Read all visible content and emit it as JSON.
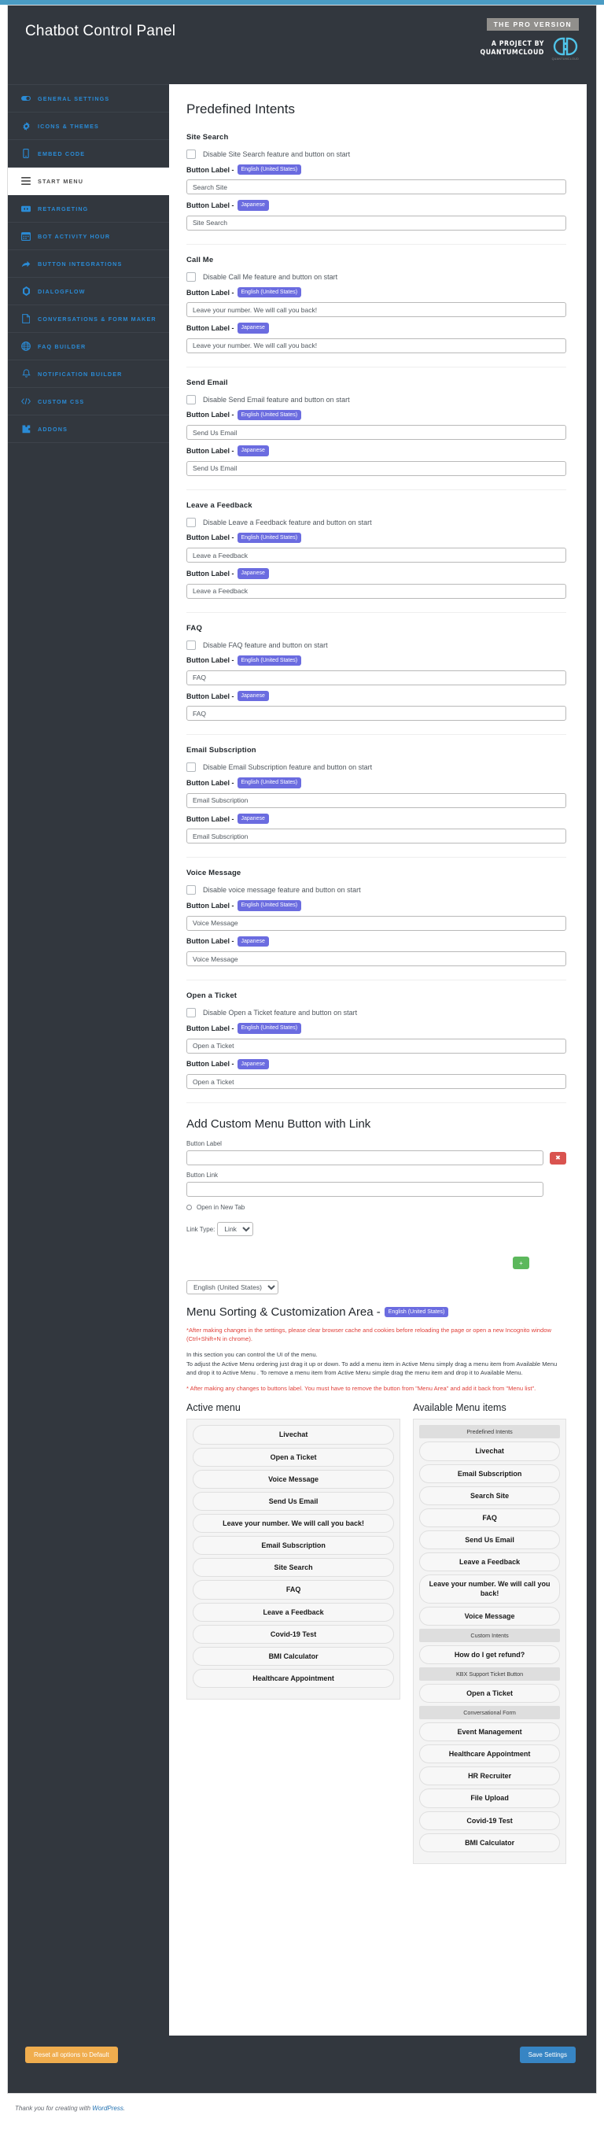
{
  "header": {
    "title": "Chatbot Control Panel",
    "pro_badge": "THE PRO VERSION",
    "project_by_line1": "A PROJECT BY",
    "project_by_line2": "QUANTUMCLOUD",
    "logo_caption": "QUANTUMCLOUD"
  },
  "sidebar": {
    "items": [
      {
        "label": "General Settings",
        "icon": "toggle-icon",
        "active": false
      },
      {
        "label": "Icons & Themes",
        "icon": "gear-icon",
        "active": false
      },
      {
        "label": "Embed Code",
        "icon": "mobile-icon",
        "active": false
      },
      {
        "label": "Start Menu",
        "icon": "hamburger-icon",
        "active": true
      },
      {
        "label": "Retargeting",
        "icon": "retarget-icon",
        "active": false
      },
      {
        "label": "Bot Activity Hour",
        "icon": "calendar-icon",
        "active": false
      },
      {
        "label": "Button Integrations",
        "icon": "share-icon",
        "active": false
      },
      {
        "label": "Dialogflow",
        "icon": "dialogflow-icon",
        "active": false
      },
      {
        "label": "Conversations & Form Maker",
        "icon": "document-icon",
        "active": false
      },
      {
        "label": "FAQ Builder",
        "icon": "globe-icon",
        "active": false
      },
      {
        "label": "Notification Builder",
        "icon": "bell-icon",
        "active": false
      },
      {
        "label": "Custom CSS",
        "icon": "code-icon",
        "active": false
      },
      {
        "label": "Addons",
        "icon": "puzzle-icon",
        "active": false
      }
    ]
  },
  "main": {
    "section_title": "Predefined Intents",
    "lang_en": "English (United States)",
    "lang_jp": "Japanese",
    "button_label_prefix": "Button Label -",
    "intents": [
      {
        "name": "Site Search",
        "disable_label": "Disable Site Search feature and button on start",
        "value_en": "Search Site",
        "value_jp": "Site Search"
      },
      {
        "name": "Call Me",
        "disable_label": "Disable Call Me feature and button on start",
        "value_en": "Leave your number. We will call you back!",
        "value_jp": "Leave your number. We will call you back!"
      },
      {
        "name": "Send Email",
        "disable_label": "Disable Send Email feature and button on start",
        "value_en": "Send Us Email",
        "value_jp": "Send Us Email"
      },
      {
        "name": "Leave a Feedback",
        "disable_label": "Disable Leave a Feedback feature and button on start",
        "value_en": "Leave a Feedback",
        "value_jp": "Leave a Feedback"
      },
      {
        "name": "FAQ",
        "disable_label": "Disable FAQ feature and button on start",
        "value_en": "FAQ",
        "value_jp": "FAQ"
      },
      {
        "name": "Email Subscription",
        "disable_label": "Disable Email Subscription feature and button on start",
        "value_en": "Email Subscription",
        "value_jp": "Email Subscription"
      },
      {
        "name": "Voice Message",
        "disable_label": "Disable voice message feature and button on start",
        "value_en": "Voice Message",
        "value_jp": "Voice Message"
      },
      {
        "name": "Open a Ticket",
        "disable_label": "Disable Open a Ticket feature and button on start",
        "value_en": "Open a Ticket",
        "value_jp": "Open a Ticket"
      }
    ],
    "custom_link": {
      "title": "Add Custom Menu Button with Link",
      "button_label_label": "Button Label",
      "button_label_value": "",
      "button_link_label": "Button Link",
      "button_link_value": "",
      "remove_icon": "✖",
      "add_icon": "+",
      "open_new_tab_label": "Open in New Tab",
      "link_type_label": "Link Type:",
      "link_type_value": "Link",
      "link_type_options": [
        "Link"
      ],
      "language_select_value": "English (United States)",
      "language_select_options": [
        "English (United States)"
      ]
    },
    "sorting": {
      "title": "Menu Sorting & Customization Area -",
      "title_badge": "English (United States)",
      "note_1": "*After making changes in the settings, please clear browser cache and cookies before reloading the page or open a new Incognito window (Ctrl+Shift+N in chrome).",
      "note_2": "In this section you can control the UI of the menu.",
      "note_3": "To adjust the Active Menu ordering just drag it up or down. To add a menu item in Active Menu simply drag a menu item from Available Menu and drop it to Active Menu . To remove a menu item from Active Menu simple drag the menu item and drop it to Available Menu.",
      "note_4": "* After making any changes to buttons label. You must have to remove the button from \"Menu Area\" and add it back from \"Menu list\".",
      "active_menu_title": "Active menu",
      "available_menu_title": "Available Menu items",
      "active_items": [
        "Livechat",
        "Open a Ticket",
        "Voice Message",
        "Send Us Email",
        "Leave your number. We will call you back!",
        "Email Subscription",
        "Site Search",
        "FAQ",
        "Leave a Feedback",
        "Covid-19 Test",
        "BMI Calculator",
        "Healthcare Appointment"
      ],
      "available_groups": [
        {
          "group": "Predefined Intents",
          "items": [
            "Livechat",
            "Email Subscription",
            "Search Site",
            "FAQ",
            "Send Us Email",
            "Leave a Feedback",
            "Leave your number. We will call you back!",
            "Voice Message"
          ]
        },
        {
          "group": "Custom Intents",
          "items": [
            "How do I get refund?"
          ]
        },
        {
          "group": "KBX Support Ticket Button",
          "items": [
            "Open a Ticket"
          ]
        },
        {
          "group": "Conversational Form",
          "items": [
            "Event Management",
            "Healthcare Appointment",
            "HR Recruiter",
            "File Upload",
            "Covid-19 Test",
            "BMI Calculator"
          ]
        }
      ]
    }
  },
  "footer": {
    "reset_label": "Reset all options to Default",
    "save_label": "Save Settings",
    "credit_prefix": "Thank you for creating with ",
    "credit_link": "WordPress",
    "credit_suffix": "."
  },
  "colors": {
    "panel_bg": "#32373e",
    "accent_blue": "#2a8bd6",
    "badge_purple": "#6b6ce0",
    "save_blue": "#3785c4",
    "reset_orange": "#f0ad4e",
    "danger_red": "#d9534f",
    "success_green": "#5cb85c",
    "topbar": "#4a9cc4"
  }
}
